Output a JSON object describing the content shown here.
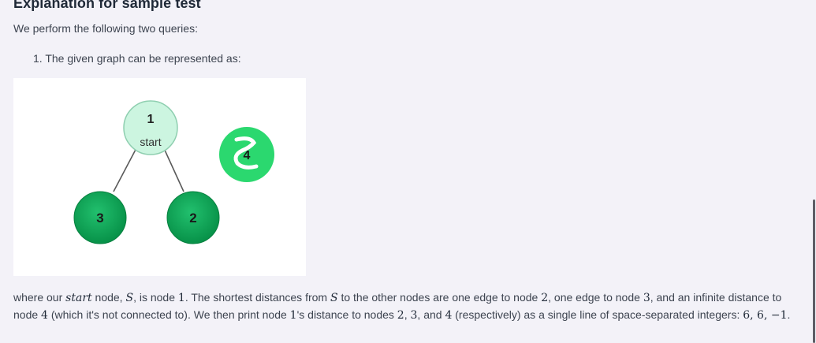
{
  "heading": "Explanation for sample test",
  "intro": "We perform the following two queries:",
  "step": {
    "number": "1.",
    "text": "The given graph can be represented as:"
  },
  "graph": {
    "nodes": [
      {
        "label": "1",
        "sublabel": "start",
        "color": "#ccf5e0"
      },
      {
        "label": "3",
        "color": "#0fa35a"
      },
      {
        "label": "2",
        "color": "#0fa35a"
      },
      {
        "label": "4",
        "color": "#2bd86f"
      }
    ],
    "edges": [
      [
        "1",
        "3"
      ],
      [
        "1",
        "2"
      ]
    ]
  },
  "description": {
    "p1": "where our",
    "start": "start",
    "p2": "node,",
    "S1": "S",
    "p3": ", is node",
    "n1": "1",
    "p4": ". The shortest distances from",
    "S2": "S",
    "p5": "to the other nodes are one edge to node",
    "n2": "2",
    "p6": ", one edge to node",
    "n3": "3",
    "p7": ", and an infinite distance to node",
    "n4": "4",
    "p8": "(which it's not connected to). We then print node",
    "n5": "1",
    "p9": "'s distance to nodes",
    "n6": "2",
    "c1": ",",
    "n7": "3",
    "p10": ", and",
    "n8": "4",
    "p11": "(respectively) as a single line of space-separated integers:",
    "result": "6, 6, −1",
    "end": "."
  },
  "colors": {
    "background": "#f3f2f8",
    "text": "#3d4450",
    "heading": "#1f2937"
  }
}
